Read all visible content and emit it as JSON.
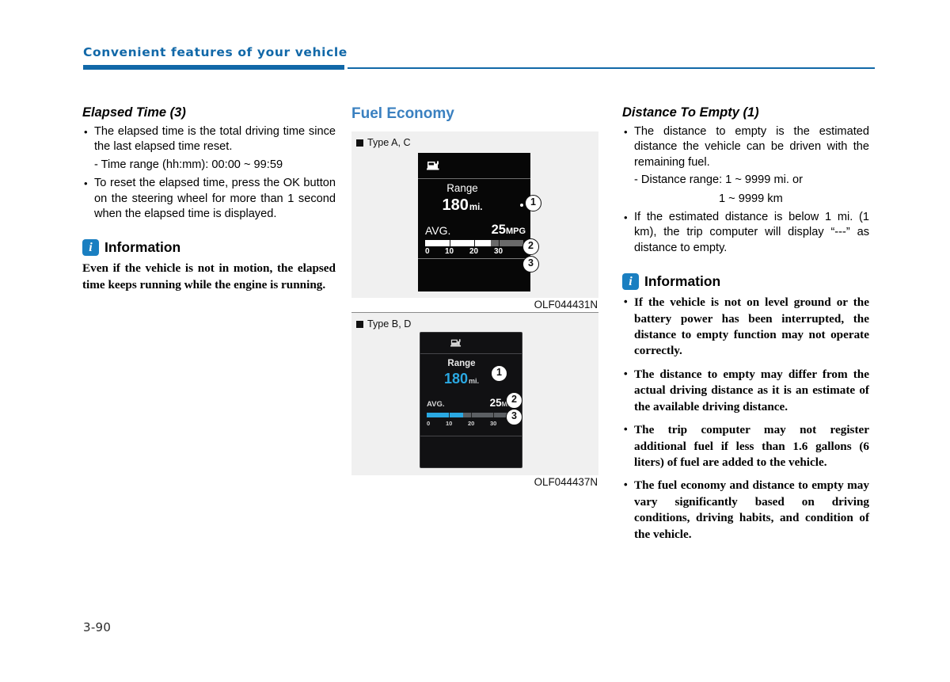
{
  "header": {
    "title": "Convenient features of your vehicle"
  },
  "page_number": "3-90",
  "left_column": {
    "heading": "Elapsed Time (3)",
    "bullets": [
      "The elapsed time is the total driving time since the last elapsed time reset.",
      "To reset the elapsed time, press the OK button on the steering wheel for more than 1 second when the elapsed time is displayed."
    ],
    "subline": "- Time range (hh:mm): 00:00 ~ 99:59",
    "information": {
      "icon": "info-icon",
      "title": "Information",
      "paragraph": "Even if the vehicle is not in motion, the elapsed time keeps  running while the engine is running."
    }
  },
  "middle_column": {
    "heading": "Fuel Economy",
    "figures": [
      {
        "type_label": "Type A, C",
        "caption": "OLF044431N",
        "display": {
          "icon": "fuel-pump-icon",
          "range_label": "Range",
          "range_value": "180",
          "range_unit": "mi.",
          "avg_label": "AVG.",
          "mpg_value": "25",
          "mpg_unit": "MPG",
          "gauge_fill_percent": 67,
          "gauge_ticks": [
            "0",
            "10",
            "20",
            "30"
          ]
        },
        "callouts": [
          "1",
          "2",
          "3"
        ]
      },
      {
        "type_label": "Type B, D",
        "caption": "OLF044437N",
        "display": {
          "icon": "fuel-pump-icon",
          "range_label": "Range",
          "range_value": "180",
          "range_unit": "mi.",
          "avg_label": "AVG.",
          "mpg_value": "25",
          "mpg_unit": "MPG",
          "gauge_fill_percent": 41,
          "gauge_ticks": [
            "0",
            "10",
            "20",
            "30"
          ]
        },
        "callouts": [
          "1",
          "2",
          "3"
        ]
      }
    ]
  },
  "right_column": {
    "heading": "Distance To Empty (1)",
    "bullets": [
      "The distance to empty is the estimated distance the vehicle can be driven with the remaining fuel.",
      "If the estimated distance is below 1 mi. (1 km), the trip computer will display “---” as distance to empty."
    ],
    "subline": "- Distance range: 1 ~ 9999 mi. or",
    "subline2": "1 ~ 9999 km",
    "information": {
      "icon": "info-icon",
      "title": "Information",
      "bullets": [
        "If the vehicle is not on level ground or the battery power has been interrupted, the distance to empty function may not operate correctly.",
        "The distance to empty may differ from the actual driving distance as it is an estimate of the available driving distance.",
        "The trip computer may not register additional fuel if less than 1.6 gallons (6 liters) of fuel are added to the vehicle.",
        "The fuel economy and distance to empty may vary significantly based on driving conditions, driving habits, and condition of the vehicle."
      ]
    }
  },
  "colors": {
    "brand_blue": "#1168a8",
    "heading_blue": "#3a80c0",
    "info_icon_blue": "#1a7fc1",
    "display_cyan": "#2aa8e2"
  }
}
